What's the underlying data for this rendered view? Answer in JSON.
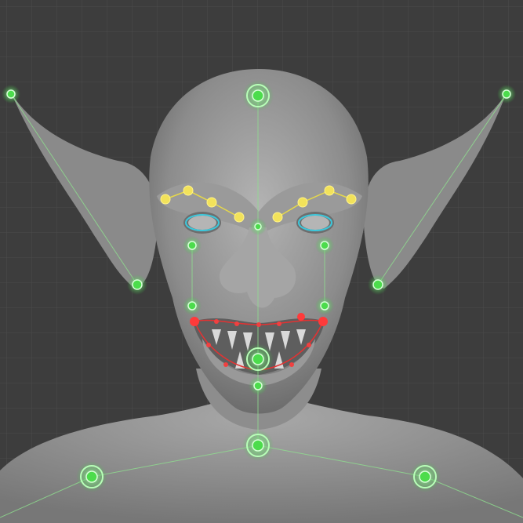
{
  "viewport": {
    "background_color": "#3d3d3d",
    "grid_color": "#4a4a4a",
    "model_color": "#8f8f8f"
  },
  "rig": {
    "control_color": "#4cdc4c",
    "brow_color": "#e6d84a",
    "eye_color": "#3cc8dc",
    "lip_color": "#e43232",
    "bone_line_color": "#9ee69e"
  },
  "controls": [
    "head-control",
    "left-ear-tip-control",
    "right-ear-tip-control",
    "left-ear-base-control",
    "right-ear-base-control",
    "nose-bridge-control",
    "left-cheek-control",
    "right-cheek-control",
    "left-mouth-corner-control",
    "right-mouth-corner-control",
    "jaw-control",
    "chin-control",
    "neck-control",
    "left-shoulder-control",
    "right-shoulder-control"
  ]
}
